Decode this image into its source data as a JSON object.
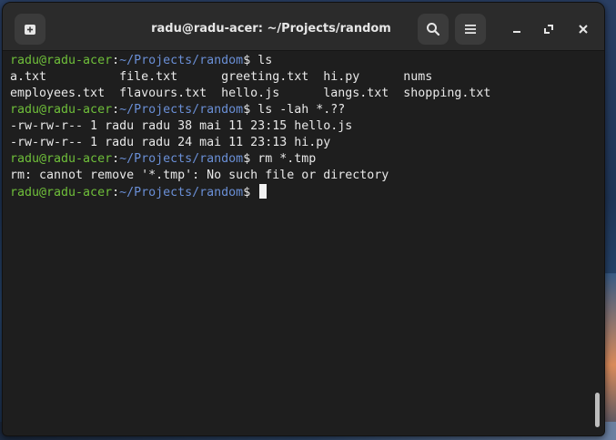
{
  "window": {
    "title": "radu@radu-acer: ~/Projects/random"
  },
  "prompt": {
    "user_host": "radu@radu-acer",
    "colon": ":",
    "path": "~/Projects/random",
    "dollar": "$"
  },
  "terminal": {
    "lines": [
      {
        "type": "prompt",
        "command": " ls"
      },
      {
        "type": "output",
        "text": "a.txt          file.txt      greeting.txt  hi.py      nums"
      },
      {
        "type": "output",
        "text": "employees.txt  flavours.txt  hello.js      langs.txt  shopping.txt"
      },
      {
        "type": "prompt",
        "command": " ls -lah *.??"
      },
      {
        "type": "output",
        "text": "-rw-rw-r-- 1 radu radu 38 mai 11 23:15 hello.js"
      },
      {
        "type": "output",
        "text": "-rw-rw-r-- 1 radu radu 24 mai 11 23:13 hi.py"
      },
      {
        "type": "prompt",
        "command": " rm *.tmp"
      },
      {
        "type": "output",
        "text": "rm: cannot remove '*.tmp': No such file or directory"
      },
      {
        "type": "prompt",
        "command": " ",
        "cursor": true
      }
    ]
  },
  "icons": {
    "new_tab": "new-tab-icon",
    "search": "search-icon",
    "menu": "hamburger-menu-icon",
    "minimize": "minimize-icon",
    "maximize": "maximize-icon",
    "close": "close-icon"
  },
  "colors": {
    "prompt_user": "#6fbf3a",
    "prompt_path": "#6a8fd6",
    "text": "#e8e8e8",
    "background": "#1e1e1e",
    "titlebar": "#2b2b2b"
  }
}
